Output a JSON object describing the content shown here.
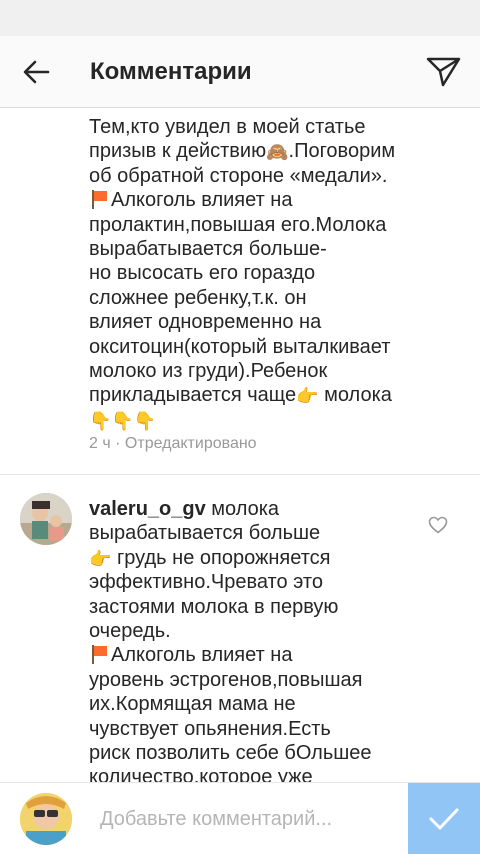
{
  "header": {
    "title": "Комментарии",
    "back_icon": "arrow-left-icon",
    "send_icon": "paper-plane-icon"
  },
  "comments": [
    {
      "lines": [
        "Тем,кто увидел в моей статье",
        "призыв к действию",
        ".Поговорим",
        "об обратной стороне «медали».",
        "Алкоголь влияет на",
        "пролактин,повышая его.Молока",
        "вырабатывается больше-",
        "но высосать его гораздо",
        "сложнее ребенку,т.к. он",
        "влияет одновременно на",
        "окситоцин(который выталкивает",
        "молоко из груди).Ребенок",
        "прикладывается чаще",
        " молока"
      ],
      "time": "2 ч",
      "edited": "Отредактировано"
    },
    {
      "username": "valeru_o_gv",
      "lines": [
        " молока",
        "вырабатывается больше",
        " грудь не опорожняется",
        "эффективно.Чревато это",
        "застоями молока в первую",
        "очередь.",
        "Алкоголь влияет на",
        "уровень эстрогенов,повышая",
        "их.Кормящая мама не",
        "чувствует опьянения.Есть",
        "риск позволить себе бОльшее",
        "количество,которое уже"
      ]
    }
  ],
  "composer": {
    "placeholder": "Добавьте комментарий...",
    "post_icon": "check-icon"
  },
  "colors": {
    "accent": "#3897f0",
    "text": "#262626",
    "meta": "#999999"
  }
}
